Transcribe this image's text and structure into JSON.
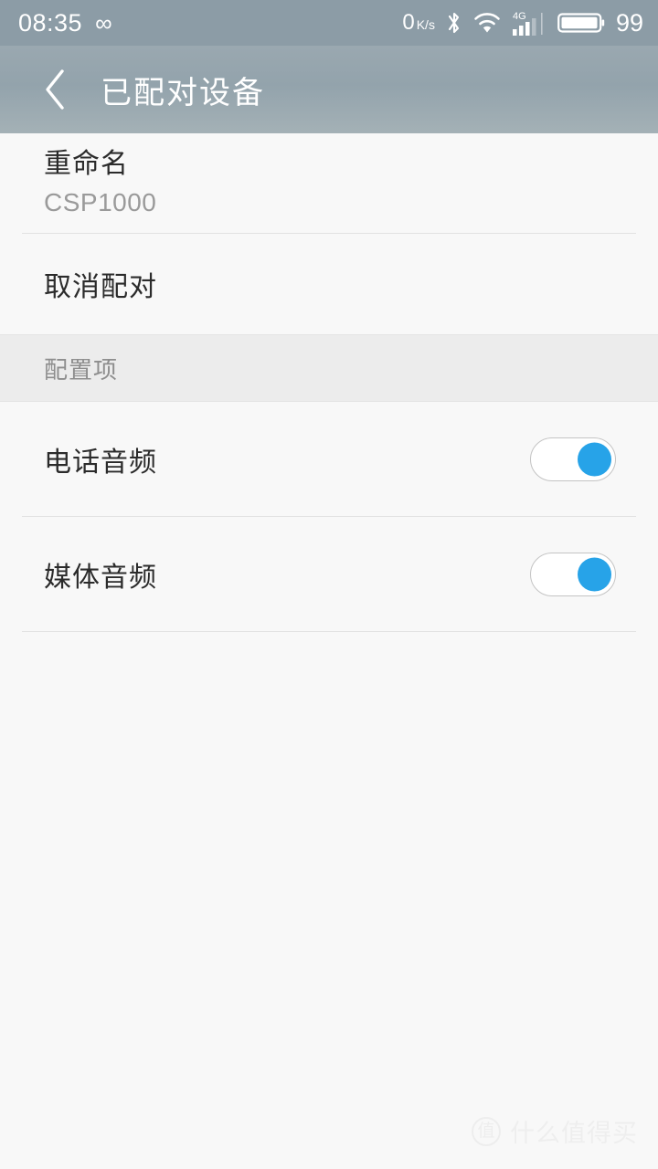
{
  "status_bar": {
    "time": "08:35",
    "infinity_glyph": "∞",
    "net_speed_value": "0",
    "net_speed_unit": "K/s",
    "bluetooth_icon": "bluetooth-icon",
    "wifi_icon": "wifi-icon",
    "network_type": "4G",
    "signal_icon": "signal-bars-icon",
    "battery_icon": "battery-icon",
    "battery_level": "99",
    "background_color": "#8c9ca6",
    "foreground_color": "#ffffff"
  },
  "header": {
    "back_icon": "chevron-left-icon",
    "title": "已配对设备",
    "background_color": "#93a3ac"
  },
  "main": {
    "rows": [
      {
        "id": "rename",
        "label": "重命名",
        "value": "CSP1000"
      },
      {
        "id": "unpair",
        "label": "取消配对"
      }
    ],
    "section": {
      "title": "配置项",
      "items": [
        {
          "id": "phone-audio",
          "label": "电话音频",
          "toggle_state": "on"
        },
        {
          "id": "media-audio",
          "label": "媒体音频",
          "toggle_state": "on"
        }
      ]
    }
  },
  "theme": {
    "page_background": "#f8f8f8",
    "section_background": "#ececec",
    "divider_color": "#e2e2e2",
    "accent_color": "#27a3e8",
    "primary_text": "#2b2b2b",
    "secondary_text": "#9a9a9a"
  },
  "watermark": {
    "badge": "值",
    "text": "什么值得买"
  }
}
